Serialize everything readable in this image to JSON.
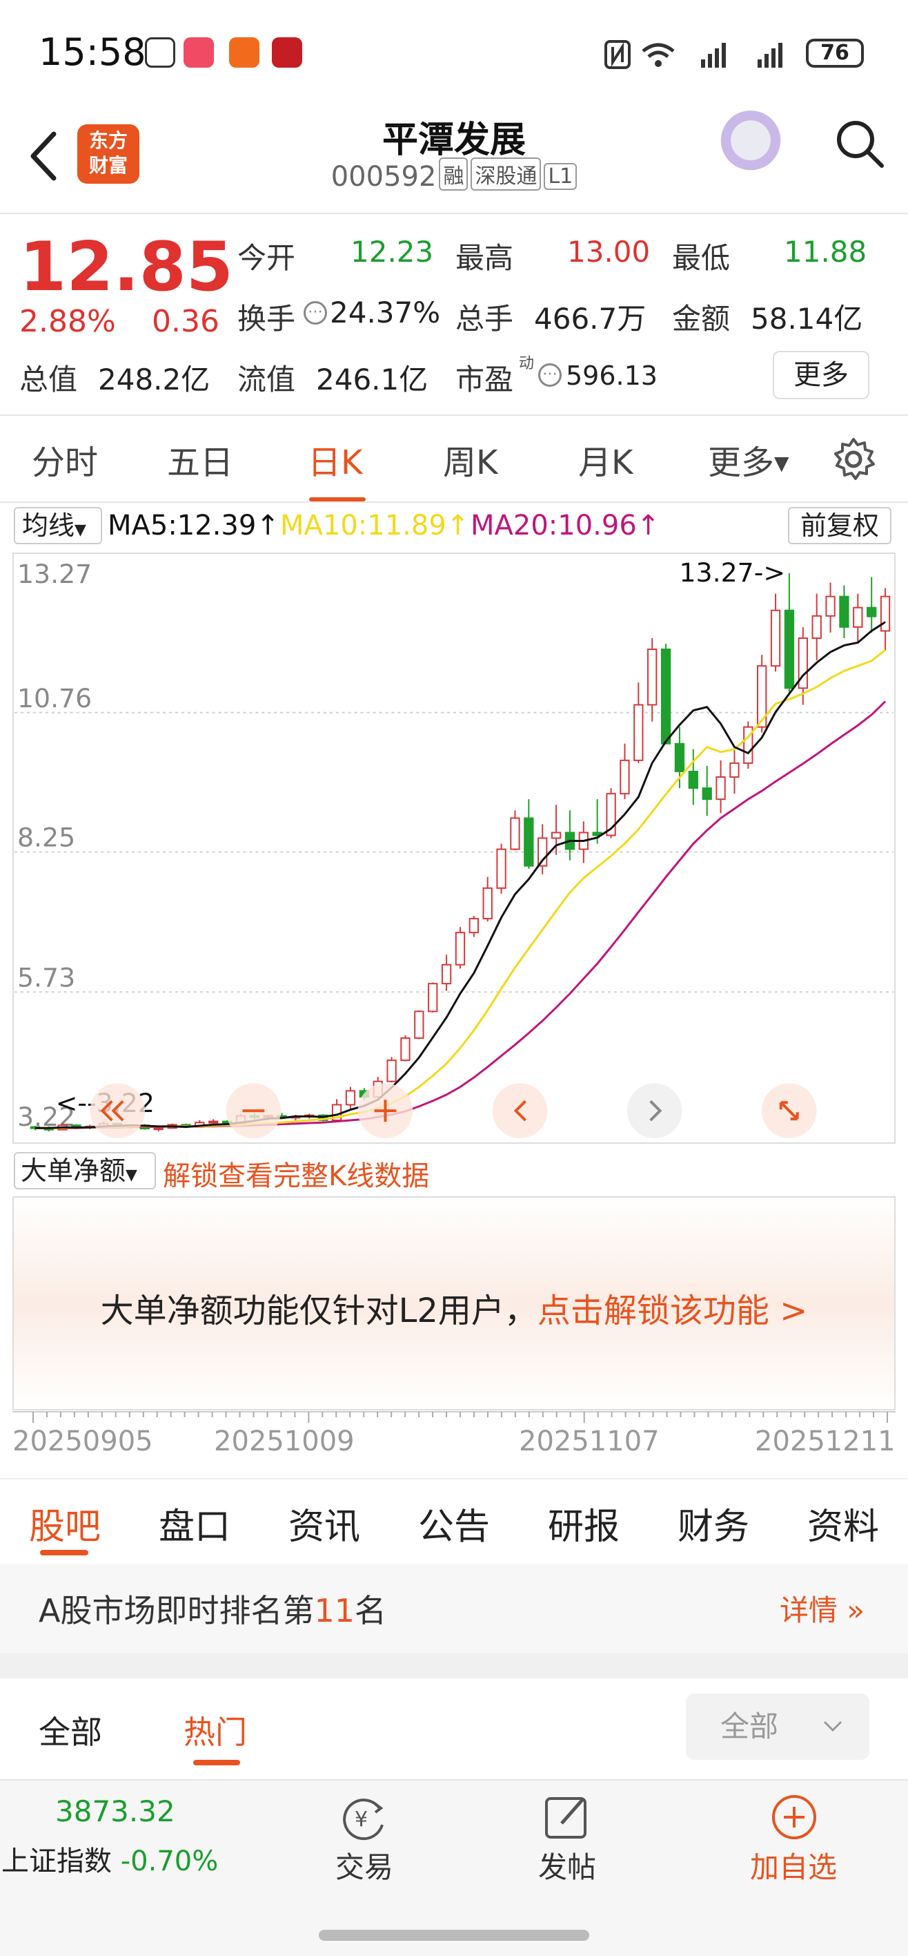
{
  "status_bar": {
    "time": "15:58",
    "battery": "76"
  },
  "header": {
    "logo_line1": "东方",
    "logo_line2": "财富",
    "name": "平潭发展",
    "code": "000592",
    "tags": [
      "融",
      "深股通",
      "L1"
    ]
  },
  "quote": {
    "price": "12.85",
    "pct_change": "2.88%",
    "change": "0.36",
    "open_label": "今开",
    "open": "12.23",
    "high_label": "最高",
    "high": "13.00",
    "low_label": "最低",
    "low": "11.88",
    "turnover_label": "换手",
    "turnover": "24.37%",
    "volume_label": "总手",
    "volume": "466.7万",
    "amount_label": "金额",
    "amount": "58.14亿",
    "mktcap_label": "总值",
    "mktcap": "248.2亿",
    "float_label": "流值",
    "float_cap": "246.1亿",
    "pe_label": "市盈",
    "pe_sup": "动",
    "pe": "596.13",
    "more_button": "更多"
  },
  "kline_tabs": [
    "分时",
    "五日",
    "日K",
    "周K",
    "月K",
    "更多"
  ],
  "active_tab": "日K",
  "ma_bar": {
    "select": "均线",
    "ma5": "MA5:12.39",
    "ma10": "MA10:11.89",
    "ma20": "MA20:10.96",
    "adjust": "前复权",
    "colors": {
      "ma5": "#111111",
      "ma10": "#f2d91c",
      "ma20": "#c1157a"
    }
  },
  "chart_data": {
    "type": "candlestick",
    "y_ticks": [
      "13.27",
      "10.76",
      "8.25",
      "5.73",
      "3.22"
    ],
    "ylim": [
      3.22,
      13.27
    ],
    "annotations": {
      "max": "13.27->",
      "min": "<--3.22"
    },
    "up_color": "#d6373a",
    "down_color": "#1fa02e",
    "candles": [
      [
        3.3,
        3.32,
        3.24,
        3.28
      ],
      [
        3.28,
        3.31,
        3.22,
        3.25
      ],
      [
        3.25,
        3.36,
        3.24,
        3.33
      ],
      [
        3.33,
        3.35,
        3.27,
        3.3
      ],
      [
        3.3,
        3.34,
        3.26,
        3.31
      ],
      [
        3.31,
        3.4,
        3.29,
        3.36
      ],
      [
        3.36,
        3.38,
        3.28,
        3.31
      ],
      [
        3.31,
        3.35,
        3.27,
        3.33
      ],
      [
        3.33,
        3.35,
        3.25,
        3.27
      ],
      [
        3.27,
        3.3,
        3.22,
        3.28
      ],
      [
        3.28,
        3.36,
        3.27,
        3.34
      ],
      [
        3.34,
        3.36,
        3.28,
        3.3
      ],
      [
        3.3,
        3.42,
        3.29,
        3.38
      ],
      [
        3.38,
        3.44,
        3.34,
        3.4
      ],
      [
        3.4,
        3.42,
        3.34,
        3.36
      ],
      [
        3.36,
        3.54,
        3.35,
        3.5
      ],
      [
        3.5,
        3.56,
        3.44,
        3.48
      ],
      [
        3.48,
        3.52,
        3.42,
        3.5
      ],
      [
        3.5,
        3.55,
        3.45,
        3.47
      ],
      [
        3.47,
        3.52,
        3.42,
        3.49
      ],
      [
        3.49,
        3.54,
        3.45,
        3.51
      ],
      [
        3.51,
        3.53,
        3.4,
        3.42
      ],
      [
        3.42,
        3.8,
        3.41,
        3.7
      ],
      [
        3.7,
        4.02,
        3.62,
        3.95
      ],
      [
        3.95,
        4.0,
        3.78,
        3.84
      ],
      [
        3.84,
        4.2,
        3.82,
        4.12
      ],
      [
        4.12,
        4.56,
        4.1,
        4.5
      ],
      [
        4.5,
        4.95,
        4.48,
        4.9
      ],
      [
        4.9,
        5.4,
        4.88,
        5.38
      ],
      [
        5.38,
        5.9,
        5.36,
        5.88
      ],
      [
        5.88,
        6.4,
        5.75,
        6.22
      ],
      [
        6.22,
        6.9,
        6.15,
        6.8
      ],
      [
        6.8,
        7.1,
        6.72,
        7.05
      ],
      [
        7.05,
        7.8,
        7.0,
        7.6
      ],
      [
        7.6,
        8.4,
        7.5,
        8.3
      ],
      [
        8.3,
        9.0,
        8.28,
        8.86
      ],
      [
        8.86,
        9.2,
        7.95,
        8.0
      ],
      [
        8.0,
        8.75,
        7.85,
        8.5
      ],
      [
        8.5,
        9.1,
        8.2,
        8.6
      ],
      [
        8.6,
        9.0,
        8.1,
        8.3
      ],
      [
        8.3,
        8.8,
        8.05,
        8.6
      ],
      [
        8.6,
        9.2,
        8.4,
        8.55
      ],
      [
        8.55,
        9.4,
        8.5,
        9.3
      ],
      [
        9.3,
        10.2,
        9.2,
        9.9
      ],
      [
        9.9,
        11.3,
        9.85,
        10.9
      ],
      [
        10.9,
        12.1,
        10.6,
        11.9
      ],
      [
        11.9,
        12.0,
        10.2,
        10.2
      ],
      [
        10.2,
        10.5,
        9.4,
        9.7
      ],
      [
        9.7,
        10.1,
        9.1,
        9.4
      ],
      [
        9.4,
        9.8,
        8.9,
        9.2
      ],
      [
        9.2,
        9.9,
        8.95,
        9.6
      ],
      [
        9.6,
        10.1,
        9.3,
        9.85
      ],
      [
        9.85,
        10.6,
        9.75,
        10.5
      ],
      [
        10.5,
        11.8,
        10.4,
        11.6
      ],
      [
        11.6,
        12.9,
        11.5,
        12.6
      ],
      [
        12.6,
        13.27,
        11.1,
        11.2
      ],
      [
        11.2,
        12.3,
        10.9,
        12.1
      ],
      [
        12.1,
        12.9,
        11.7,
        12.5
      ],
      [
        12.5,
        13.1,
        12.2,
        12.85
      ],
      [
        12.85,
        13.05,
        12.1,
        12.3
      ],
      [
        12.3,
        12.9,
        12.0,
        12.65
      ],
      [
        12.65,
        13.2,
        12.2,
        12.49
      ],
      [
        12.23,
        13.0,
        11.88,
        12.85
      ]
    ],
    "ma5": [
      3.28,
      3.28,
      3.29,
      3.29,
      3.29,
      3.31,
      3.32,
      3.33,
      3.32,
      3.31,
      3.31,
      3.3,
      3.32,
      3.34,
      3.35,
      3.38,
      3.41,
      3.45,
      3.46,
      3.49,
      3.49,
      3.48,
      3.52,
      3.61,
      3.68,
      3.79,
      4.01,
      4.26,
      4.55,
      4.91,
      5.27,
      5.7,
      6.07,
      6.56,
      7.07,
      7.49,
      7.76,
      8.1,
      8.37,
      8.45,
      8.45,
      8.51,
      8.67,
      8.93,
      9.24,
      9.85,
      10.24,
      10.54,
      10.8,
      10.86,
      10.56,
      10.14,
      10.03,
      10.31,
      10.77,
      11.1,
      11.43,
      11.66,
      11.85,
      11.97,
      12.02,
      12.23,
      12.39
    ],
    "ma10": [
      3.28,
      3.28,
      3.28,
      3.29,
      3.29,
      3.3,
      3.3,
      3.31,
      3.31,
      3.31,
      3.31,
      3.31,
      3.31,
      3.32,
      3.33,
      3.34,
      3.36,
      3.37,
      3.38,
      3.4,
      3.42,
      3.44,
      3.47,
      3.53,
      3.57,
      3.64,
      3.73,
      3.85,
      4.02,
      4.22,
      4.44,
      4.72,
      5.04,
      5.4,
      5.79,
      6.17,
      6.51,
      6.85,
      7.19,
      7.52,
      7.78,
      7.98,
      8.18,
      8.4,
      8.66,
      8.97,
      9.29,
      9.59,
      9.88,
      10.14,
      10.05,
      10.1,
      10.32,
      10.62,
      10.92,
      11.0,
      11.1,
      11.22,
      11.38,
      11.51,
      11.6,
      11.69,
      11.89
    ],
    "ma20": [
      3.28,
      3.28,
      3.28,
      3.28,
      3.29,
      3.29,
      3.29,
      3.3,
      3.3,
      3.3,
      3.31,
      3.31,
      3.31,
      3.31,
      3.32,
      3.32,
      3.33,
      3.34,
      3.35,
      3.36,
      3.37,
      3.38,
      3.4,
      3.42,
      3.44,
      3.48,
      3.52,
      3.58,
      3.67,
      3.77,
      3.88,
      4.02,
      4.19,
      4.38,
      4.58,
      4.78,
      4.99,
      5.21,
      5.45,
      5.7,
      5.97,
      6.24,
      6.54,
      6.85,
      7.17,
      7.48,
      7.8,
      8.1,
      8.4,
      8.64,
      8.86,
      9.03,
      9.2,
      9.35,
      9.52,
      9.68,
      9.84,
      10.01,
      10.19,
      10.36,
      10.53,
      10.72,
      10.96
    ]
  },
  "net_flow": {
    "select": "大单净额",
    "unlock_link": "解锁查看完整K线数据",
    "message": "大单净额功能仅针对L2用户，",
    "message_link": "点击解锁该功能 >"
  },
  "dates": [
    "20250905",
    "20251009",
    "20251107",
    "20251211"
  ],
  "bottom_tabs": [
    "股吧",
    "盘口",
    "资讯",
    "公告",
    "研报",
    "财务",
    "资料"
  ],
  "rank": {
    "prefix": "A股市场即时排名第",
    "number": "11",
    "suffix": "名",
    "detail": "详情"
  },
  "forum_tabs": [
    "全部",
    "热门"
  ],
  "forum_filter": "全部",
  "bottom_nav": {
    "index_value": "3873.32",
    "index_name": "上证指数",
    "index_change": "-0.70%",
    "trade": "交易",
    "post": "发帖",
    "add_watch": "加自选"
  }
}
